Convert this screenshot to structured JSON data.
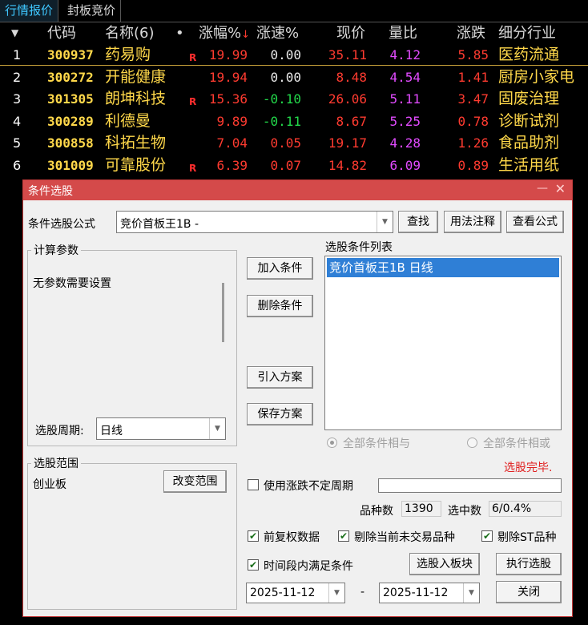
{
  "tabs": [
    "行情报价",
    "封板竞价"
  ],
  "table": {
    "headers": {
      "code": "代码",
      "name": "名称(6)",
      "dot": "•",
      "pct": "涨幅%",
      "pct_sort": "↓",
      "speed": "涨速%",
      "price": "现价",
      "vol_ratio": "量比",
      "change": "涨跌",
      "industry": "细分行业",
      "dropdown": "▼"
    },
    "rows": [
      {
        "idx": "1",
        "code": "300937",
        "name": "药易购",
        "flag": "R",
        "pct": "19.99",
        "speed": "0.00",
        "price": "35.11",
        "vol_ratio": "4.12",
        "change": "5.85",
        "industry": "医药流通"
      },
      {
        "idx": "2",
        "code": "300272",
        "name": "开能健康",
        "flag": "",
        "pct": "19.94",
        "speed": "0.00",
        "price": "8.48",
        "vol_ratio": "4.54",
        "change": "1.41",
        "industry": "厨房小家电"
      },
      {
        "idx": "3",
        "code": "301305",
        "name": "朗坤科技",
        "flag": "R",
        "pct": "15.36",
        "speed": "-0.10",
        "price": "26.06",
        "vol_ratio": "5.11",
        "change": "3.47",
        "industry": "固废治理"
      },
      {
        "idx": "4",
        "code": "300289",
        "name": "利德曼",
        "flag": "",
        "pct": "9.89",
        "speed": "-0.11",
        "price": "8.67",
        "vol_ratio": "5.25",
        "change": "0.78",
        "industry": "诊断试剂"
      },
      {
        "idx": "5",
        "code": "300858",
        "name": "科拓生物",
        "flag": "",
        "pct": "7.04",
        "speed": "0.05",
        "price": "19.17",
        "vol_ratio": "4.28",
        "change": "1.26",
        "industry": "食品助剂"
      },
      {
        "idx": "6",
        "code": "301009",
        "name": "可靠股份",
        "flag": "R",
        "pct": "6.39",
        "speed": "0.07",
        "price": "14.82",
        "vol_ratio": "6.09",
        "change": "0.89",
        "industry": "生活用纸"
      }
    ]
  },
  "dialog": {
    "title": "条件选股",
    "min_icon": "—",
    "close_icon": "✕",
    "formula_label": "条件选股公式",
    "formula_value": "竞价首板王1B  -",
    "btn_find": "查找",
    "btn_usage": "用法注释",
    "btn_view": "查看公式",
    "params_legend": "计算参数",
    "params_text": "无参数需要设置",
    "period_label": "选股周期:",
    "period_value": "日线",
    "btn_add": "加入条件",
    "btn_delete": "删除条件",
    "btn_import": "引入方案",
    "btn_save": "保存方案",
    "cond_list_label": "选股条件列表",
    "cond_items": [
      "竞价首板王1B  日线"
    ],
    "radio_and": "全部条件相与",
    "radio_or": "全部条件相或",
    "status": "选股完毕.",
    "range_legend": "选股范围",
    "range_value": "创业板",
    "btn_change_range": "改变范围",
    "use_period_label": "使用涨跌不定周期",
    "count_label": "品种数",
    "count_value": "1390",
    "selected_label": "选中数",
    "selected_value": "6/0.4%",
    "chk_prev_adj": "前复权数据",
    "chk_exclude_no_trade": "剔除当前未交易品种",
    "chk_exclude_st": "剔除ST品种",
    "chk_time_range": "时间段内满足条件",
    "btn_to_block": "选股入板块",
    "btn_execute": "执行选股",
    "date_from": "2025-11-12",
    "date_sep": "-",
    "date_to": "2025-11-12",
    "btn_close": "关闭"
  },
  "colors": {
    "up": "#ff3b30",
    "down": "#22d84a",
    "stock_name": "#ffd84a",
    "volume_ratio": "#e24bff",
    "dialog_title": "#d44a4a",
    "selection": "#2f7fd6"
  }
}
